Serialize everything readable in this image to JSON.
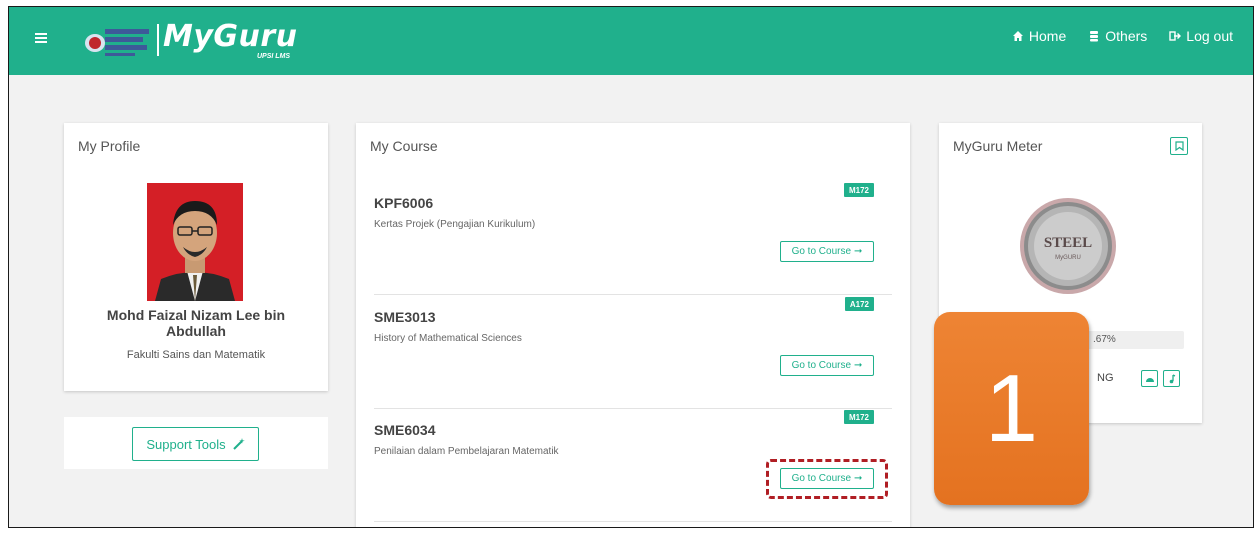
{
  "app": {
    "brand": "MyGuru",
    "brand_sub": "UPSI LMS"
  },
  "nav": {
    "home": "Home",
    "others": "Others",
    "logout": "Log out"
  },
  "profile": {
    "title": "My Profile",
    "name": "Mohd Faizal Nizam Lee bin Abdullah",
    "faculty": "Fakulti Sains dan Matematik"
  },
  "support": {
    "label": "Support Tools"
  },
  "course": {
    "title": "My Course",
    "go_label": "Go to Course",
    "items": [
      {
        "code": "KPF6006",
        "name": "Kertas Projek (Pengajian Kurikulum)",
        "badge": "M172"
      },
      {
        "code": "SME3013",
        "name": "History of Mathematical Sciences",
        "badge": "A172"
      },
      {
        "code": "SME6034",
        "name": "Penilaian dalam Pembelajaran Matematik",
        "badge": "M172"
      }
    ]
  },
  "meter": {
    "title": "MyGuru Meter",
    "medal_text": "STEEL",
    "medal_sub": "MyGURU",
    "progress_text": ".67%",
    "level_text": "NG"
  },
  "callout": {
    "step": "1"
  },
  "colors": {
    "primary": "#20b08c",
    "callout": "#e8792a",
    "highlight": "#b01e24"
  }
}
